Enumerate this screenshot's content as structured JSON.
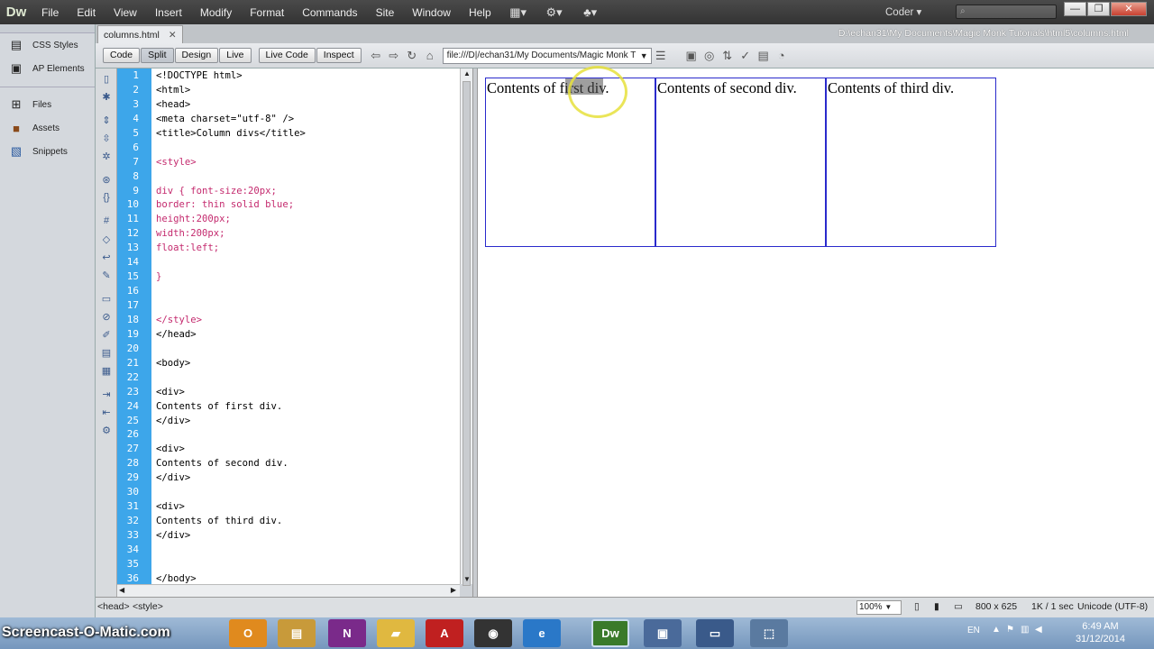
{
  "menubar": {
    "logo": "Dw",
    "items": [
      "File",
      "Edit",
      "View",
      "Insert",
      "Modify",
      "Format",
      "Commands",
      "Site",
      "Window",
      "Help"
    ],
    "workspace": "Coder",
    "search_placeholder": "",
    "window_controls": [
      "minimize",
      "restore",
      "close"
    ]
  },
  "left_panel": {
    "group1": [
      {
        "label": "CSS Styles",
        "icon": "css-styles-icon"
      },
      {
        "label": "AP Elements",
        "icon": "ap-elements-icon"
      }
    ],
    "group2": [
      {
        "label": "Files",
        "icon": "files-icon"
      },
      {
        "label": "Assets",
        "icon": "assets-icon"
      },
      {
        "label": "Snippets",
        "icon": "snippets-icon"
      }
    ]
  },
  "document": {
    "tab_title": "columns.html",
    "file_path": "D:\\echan31\\My Documents\\Magic Monk Tutorials\\html5\\columns.html"
  },
  "toolbar": {
    "buttons": [
      "Code",
      "Split",
      "Design",
      "Live",
      "Live Code",
      "Inspect"
    ],
    "active": "Split",
    "address": "file:///D|/echan31/My Documents/Magic Monk T"
  },
  "code": {
    "lines": [
      {
        "n": "1",
        "text": "<!DOCTYPE html>",
        "kind": "tag"
      },
      {
        "n": "2",
        "text": "<html>",
        "kind": "tag"
      },
      {
        "n": "3",
        "text": "<head>",
        "kind": "tag"
      },
      {
        "n": "4",
        "text": "<meta charset=\"utf-8\" />",
        "kind": "tag"
      },
      {
        "n": "5",
        "text": "<title>Column divs</title>",
        "kind": "tag"
      },
      {
        "n": "6",
        "text": "",
        "kind": "tag"
      },
      {
        "n": "7",
        "text": "<style>",
        "kind": "css"
      },
      {
        "n": "8",
        "text": "",
        "kind": "css"
      },
      {
        "n": "9",
        "text": "div { font-size:20px;",
        "kind": "css"
      },
      {
        "n": "10",
        "text": "border: thin solid blue;",
        "kind": "css"
      },
      {
        "n": "11",
        "text": "height:200px;",
        "kind": "css"
      },
      {
        "n": "12",
        "text": "width:200px;",
        "kind": "css"
      },
      {
        "n": "13",
        "text": "float:left;",
        "kind": "css"
      },
      {
        "n": "14",
        "text": "",
        "kind": "css"
      },
      {
        "n": "15",
        "text": "}",
        "kind": "css"
      },
      {
        "n": "16",
        "text": "",
        "kind": "css"
      },
      {
        "n": "17",
        "text": "",
        "kind": "css"
      },
      {
        "n": "18",
        "text": "</style>",
        "kind": "css"
      },
      {
        "n": "19",
        "text": "</head>",
        "kind": "tag"
      },
      {
        "n": "20",
        "text": "",
        "kind": "tag"
      },
      {
        "n": "21",
        "text": "<body>",
        "kind": "tag"
      },
      {
        "n": "22",
        "text": "",
        "kind": "tag"
      },
      {
        "n": "23",
        "text": "<div>",
        "kind": "tag"
      },
      {
        "n": "24",
        "text": "Contents of first div.",
        "kind": "tag"
      },
      {
        "n": "25",
        "text": "</div>",
        "kind": "tag"
      },
      {
        "n": "26",
        "text": "",
        "kind": "tag"
      },
      {
        "n": "27",
        "text": "<div>",
        "kind": "tag"
      },
      {
        "n": "28",
        "text": "Contents of second div.",
        "kind": "tag"
      },
      {
        "n": "29",
        "text": "</div>",
        "kind": "tag"
      },
      {
        "n": "30",
        "text": "",
        "kind": "tag"
      },
      {
        "n": "31",
        "text": "<div>",
        "kind": "tag"
      },
      {
        "n": "32",
        "text": "Contents of third div.",
        "kind": "tag"
      },
      {
        "n": "33",
        "text": "</div>",
        "kind": "tag"
      },
      {
        "n": "34",
        "text": "",
        "kind": "tag"
      },
      {
        "n": "35",
        "text": "",
        "kind": "tag"
      },
      {
        "n": "36",
        "text": "</body>",
        "kind": "tag"
      }
    ]
  },
  "live_view": {
    "divs": [
      "Contents of first div.",
      "Contents of second div.",
      "Contents of third div."
    ]
  },
  "status": {
    "tag_selector": [
      "<head>",
      "<style>"
    ],
    "zoom": "100%",
    "dimensions": "800 x 625",
    "download": "1K / 1 sec",
    "encoding": "Unicode (UTF-8)"
  },
  "taskbar": {
    "watermark": "Screencast-O-Matic.com",
    "language": "EN",
    "time": "6:49 AM",
    "date": "31/12/2014",
    "apps": [
      "outlook",
      "explorer",
      "onenote",
      "folder",
      "acrobat",
      "media",
      "internet-explorer",
      "dreamweaver",
      "network",
      "photo",
      "snipping"
    ]
  },
  "colors": {
    "gutter": "#3da6ea",
    "css_code": "#c42a6e",
    "div_border": "#2a2acc",
    "menubar": "#3a3a3a"
  }
}
